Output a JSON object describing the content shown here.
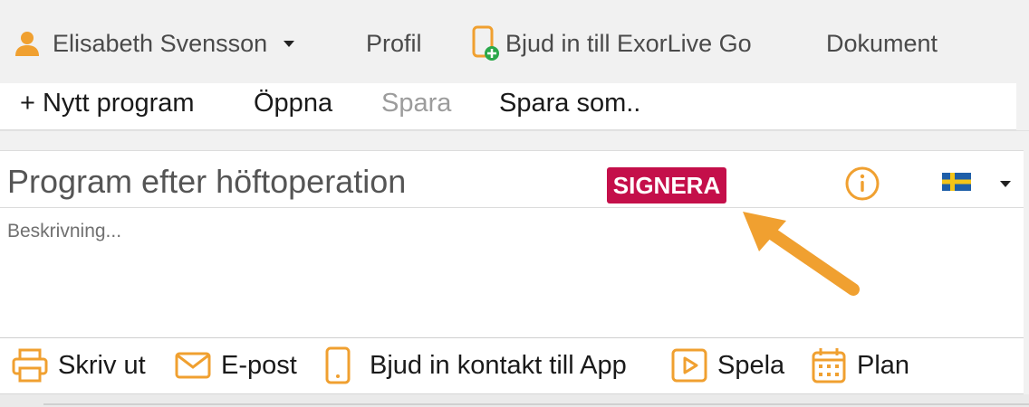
{
  "topbar": {
    "user_name": "Elisabeth Svensson",
    "profile": "Profil",
    "invite": "Bjud in till ExorLive Go",
    "documents": "Dokument"
  },
  "toolbar": {
    "new_program": "+ Nytt program",
    "open": "Öppna",
    "save": "Spara",
    "save_as": "Spara som.."
  },
  "program": {
    "title": "Program efter höftoperation",
    "sign_label": "SIGNERA",
    "description_placeholder": "Beskrivning..."
  },
  "actions": {
    "print": "Skriv ut",
    "email": "E-post",
    "invite_app": "Bjud in kontakt till App",
    "play": "Spela",
    "plan": "Plan"
  },
  "colors": {
    "accent": "#f0a030",
    "sign_button": "#c40f4a",
    "invite_plus": "#2aa84a"
  },
  "icons": {
    "user": "user-icon",
    "phone_plus": "phone-add-icon",
    "info": "info-icon",
    "flag": "swedish-flag-icon",
    "printer": "printer-icon",
    "mail": "mail-icon",
    "phone": "phone-icon",
    "play": "play-icon",
    "calendar": "calendar-icon"
  }
}
